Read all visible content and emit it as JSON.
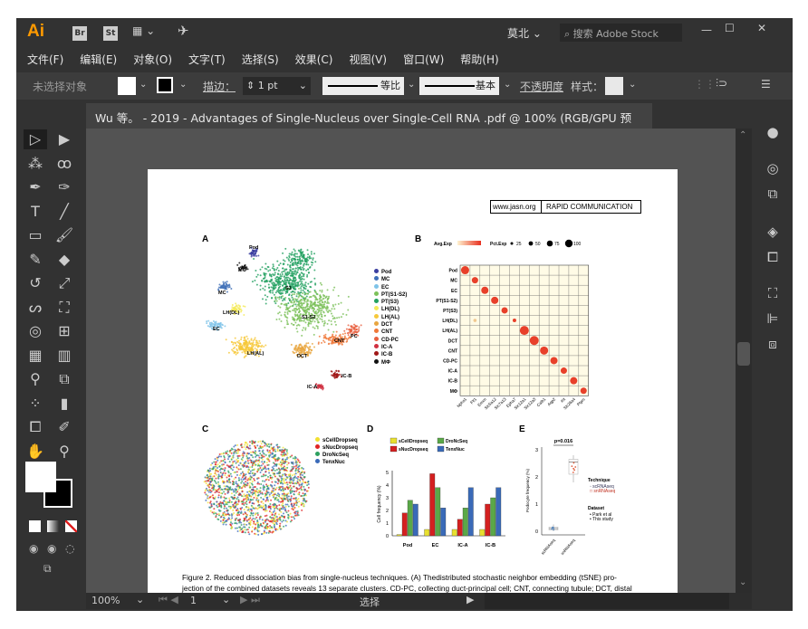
{
  "app": {
    "logo": "Ai",
    "bridge": "Br",
    "stock": "St",
    "workspace": "莫北",
    "search_placeholder": "搜索 Adobe Stock"
  },
  "menu": [
    "文件(F)",
    "编辑(E)",
    "对象(O)",
    "文字(T)",
    "选择(S)",
    "效果(C)",
    "视图(V)",
    "窗口(W)",
    "帮助(H)"
  ],
  "control": {
    "selection": "未选择对象",
    "stroke_label": "描边：",
    "stroke_value": "1 pt",
    "profile1": "等比",
    "profile2": "基本",
    "opacity_label": "不透明度",
    "style_label": "样式："
  },
  "tab": {
    "title": "Wu 等。 - 2019 - Advantages of Single-Nucleus over Single-Cell RNA .pdf @ 100% (RGB/GPU 预览)",
    "close": "×"
  },
  "status": {
    "zoom": "100%",
    "page": "1",
    "tool": "选择"
  },
  "document": {
    "site": "www.jasn.org",
    "section": "RAPID COMMUNICATION",
    "panels": [
      "A",
      "B",
      "C",
      "D",
      "E"
    ],
    "panel_a": {
      "legend": [
        {
          "label": "Pod",
          "color": "#3b3fa0"
        },
        {
          "label": "MC",
          "color": "#3e6fb8"
        },
        {
          "label": "EC",
          "color": "#7ec3e8"
        },
        {
          "label": "PT(S1-S2)",
          "color": "#7cc15a"
        },
        {
          "label": "PT(S3)",
          "color": "#22a060"
        },
        {
          "label": "LH(DL)",
          "color": "#f4ea5a"
        },
        {
          "label": "LH(AL)",
          "color": "#f6c83a"
        },
        {
          "label": "DCT",
          "color": "#e8a640"
        },
        {
          "label": "CNT",
          "color": "#f07838"
        },
        {
          "label": "CD-PC",
          "color": "#e86040"
        },
        {
          "label": "IC-A",
          "color": "#d03040"
        },
        {
          "label": "IC-B",
          "color": "#a01818"
        },
        {
          "label": "MΦ",
          "color": "#111111"
        }
      ],
      "cluster_labels": [
        "Pod",
        "MΦ",
        "MC",
        "S3",
        "S1-S2",
        "LH(DL)",
        "EC",
        "LH(AL)",
        "DCT",
        "CNT",
        "PC",
        "IC-B",
        "IC-A"
      ]
    },
    "panel_b": {
      "avg_label": "Avg.Exp",
      "pct_label": "Pct.Exp",
      "pct_values": [
        "25",
        "50",
        "75",
        "100"
      ],
      "rows": [
        "Pod",
        "MC",
        "EC",
        "PT(S1-S2)",
        "PT(S3)",
        "LH(DL)",
        "LH(AL)",
        "DCT",
        "CNT",
        "CD-PC",
        "IC-A",
        "IC-B",
        "MΦ"
      ],
      "genes": [
        "Nphs1",
        "Flt1",
        "Emcn",
        "Slc5a12",
        "Slc7a13",
        "Epha7",
        "Slc12a1",
        "Slc12a3",
        "Calb1",
        "Aqp2",
        "Kit",
        "Slc26a4",
        "Ptprc"
      ]
    },
    "panel_c": {
      "legend": [
        {
          "label": "sCellDropseq",
          "color": "#f2e030"
        },
        {
          "label": "sNucDropseq",
          "color": "#e02424"
        },
        {
          "label": "DroNcSeq",
          "color": "#2ea060"
        },
        {
          "label": "TenxNuc",
          "color": "#3a6ab8"
        }
      ]
    },
    "chart_data": [
      {
        "type": "bar",
        "ylabel": "Cell frequency (%)",
        "ylim": [
          0,
          5
        ],
        "yticks": [
          "0",
          "1",
          "2",
          "3",
          "4",
          "5"
        ],
        "categories": [
          "Pod",
          "EC",
          "IC-A",
          "IC-B"
        ],
        "series": [
          {
            "name": "sCellDropseq",
            "color": "#e8e030",
            "values": [
              0.1,
              0.5,
              0.5,
              0.5
            ]
          },
          {
            "name": "sNucDropseq",
            "color": "#d42020",
            "values": [
              1.8,
              4.9,
              1.3,
              2.5
            ]
          },
          {
            "name": "DroNcSeq",
            "color": "#5aa848",
            "values": [
              2.8,
              3.8,
              2.2,
              3.0
            ]
          },
          {
            "name": "TenxNuc",
            "color": "#3a6ab8",
            "values": [
              2.5,
              2.2,
              3.8,
              3.8
            ]
          }
        ],
        "legend": "top"
      },
      {
        "type": "box",
        "ylabel": "Podocyte frequency (%)",
        "ylim": [
          0,
          3
        ],
        "yticks": [
          "0",
          "1",
          "2",
          "3"
        ],
        "categories": [
          "scRNAseq",
          "snRNAseq"
        ],
        "annotation": "p=0.016",
        "boxes": [
          {
            "min": 0,
            "q1": 0.05,
            "median": 0.1,
            "q3": 0.15,
            "max": 0.25
          },
          {
            "min": 1.8,
            "q1": 2.1,
            "median": 2.55,
            "q3": 2.65,
            "max": 2.8
          }
        ],
        "legend_technique_title": "Technique",
        "legend_technique": [
          "scRNAseq",
          "snRNAseq"
        ],
        "legend_dataset_title": "Dataset",
        "legend_dataset": [
          "Park et al",
          "This study"
        ]
      }
    ],
    "caption_line1": "Figure 2.  Reduced dissociation bias from single-nucleus techniques. (A) Thedistributed stochastic neighbor embedding (tSNE) pro-",
    "caption_line2": "jection of the combined datasets reveals 13 separate clusters. CD-PC, collecting duct-principal cell; CNT, connecting tubule; DCT, distal"
  }
}
